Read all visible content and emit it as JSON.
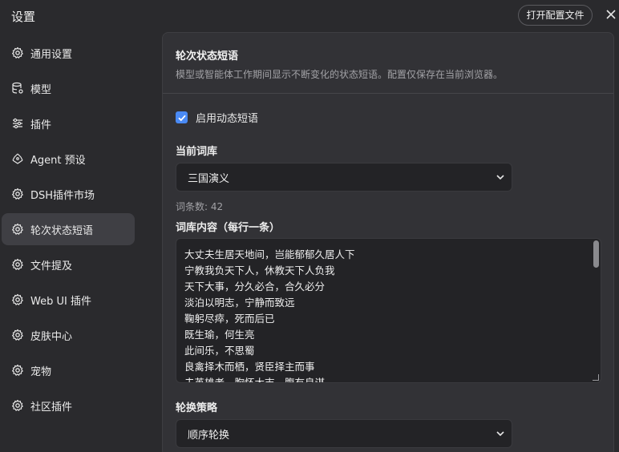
{
  "header": {
    "title": "设置",
    "open_config_label": "打开配置文件"
  },
  "sidebar": {
    "items": [
      {
        "label": "通用设置",
        "icon": "gear-icon"
      },
      {
        "label": "模型",
        "icon": "database-icon"
      },
      {
        "label": "插件",
        "icon": "sliders-icon"
      },
      {
        "label": "Agent 预设",
        "icon": "agent-icon"
      },
      {
        "label": "DSH插件市场",
        "icon": "gear-icon"
      },
      {
        "label": "轮次状态短语",
        "icon": "gear-icon",
        "active": true
      },
      {
        "label": "文件提及",
        "icon": "gear-icon"
      },
      {
        "label": "Web UI 插件",
        "icon": "gear-icon"
      },
      {
        "label": "皮肤中心",
        "icon": "gear-icon"
      },
      {
        "label": "宠物",
        "icon": "gear-icon"
      },
      {
        "label": "社区插件",
        "icon": "gear-icon"
      }
    ]
  },
  "panel": {
    "title": "轮次状态短语",
    "description": "模型或智能体工作期间显示不断变化的状态短语。配置仅保存在当前浏览器。",
    "enable_label": "启用动态短语",
    "enable_checked": true,
    "library_label": "当前词库",
    "library_selected": "三国演义",
    "count_label": "词条数: 42",
    "content_label": "词库内容（每行一条）",
    "content_lines": [
      "大丈夫生居天地间，岂能郁郁久居人下",
      "宁教我负天下人，休教天下人负我",
      "天下大事，分久必合，合久必分",
      "淡泊以明志，宁静而致远",
      "鞠躬尽瘁，死而后已",
      "既生瑜，何生亮",
      "此间乐，不思蜀",
      "良禽择木而栖，贤臣择主而事",
      "夫英雄者，胸怀大志，腹有良谋"
    ],
    "strategy_label": "轮换策略",
    "strategy_selected": "顺序轮换"
  },
  "colors": {
    "accent": "#4a8af4",
    "background": "#2a2a2d",
    "panel": "#323236"
  }
}
